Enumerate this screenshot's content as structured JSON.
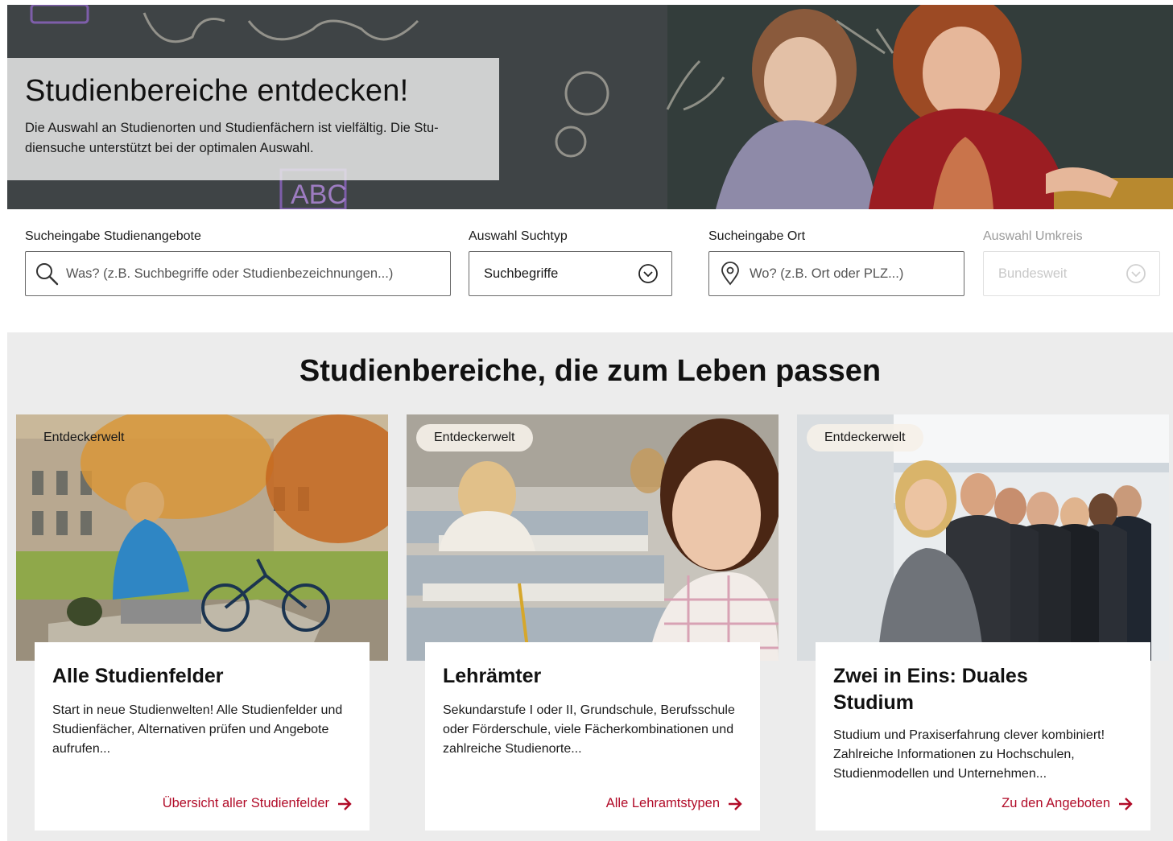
{
  "hero": {
    "title": "Studienbereiche entdecken!",
    "text": "Die Auswahl an Studienorten und Studienfächern ist vielfältig. Die Stu-diensuche unterstützt bei der optimalen Auswahl.",
    "chalk_text": "ABC"
  },
  "search": {
    "query_label": "Sucheingabe Studienangebote",
    "query_placeholder": "Was? (z.B. Suchbegriffe oder Studienbezeichnungen...)",
    "type_label": "Auswahl Suchtyp",
    "type_value": "Suchbegriffe",
    "location_label": "Sucheingabe Ort",
    "location_placeholder": "Wo? (z.B. Ort oder PLZ...)",
    "radius_label": "Auswahl Umkreis",
    "radius_value": "Bundesweit"
  },
  "section": {
    "title": "Studienbereiche, die zum Leben passen"
  },
  "cards": [
    {
      "badge": "Entdeckerwelt",
      "title": "Alle Studienfelder",
      "text": "Start in neue Studienwelten! Alle Studienfelder und Studienfächer, Alternativen prüfen und Angebote aufrufen...",
      "link": "Übersicht aller Studienfelder"
    },
    {
      "badge": "Entdeckerwelt",
      "title": "Lehrämter",
      "text": "Sekundarstufe I oder II, Grundschule, Berufsschule oder Förderschule, viele Fächerkombinationen und zahlreiche Studienorte...",
      "link": "Alle Lehramtstypen"
    },
    {
      "badge": "Entdeckerwelt",
      "title": "Zwei in Eins: Duales Studium",
      "text": "Studium und Praxiserfahrung clever kombiniert! Zahlreiche Informationen zu Hochschulen, Studienmodellen und Unternehmen...",
      "link": "Zu den Angeboten"
    }
  ],
  "colors": {
    "accent": "#b10b28",
    "section_bg": "#ececec"
  },
  "icons": {
    "search": "search-icon",
    "dropdown": "chevron-down-circle-icon",
    "location": "location-pin-icon",
    "arrow": "arrow-right-icon"
  }
}
